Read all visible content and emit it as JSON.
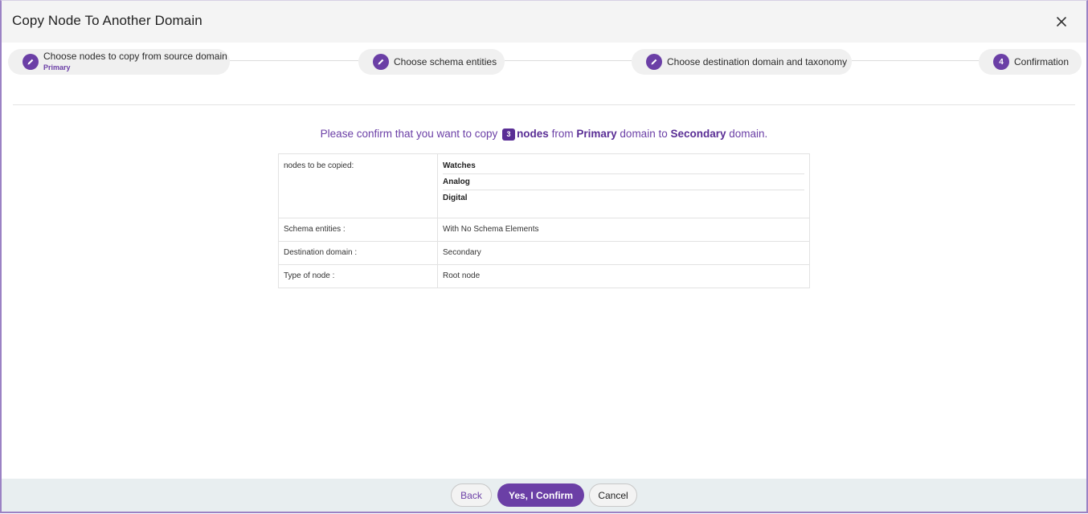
{
  "dialog": {
    "title": "Copy Node To Another Domain",
    "close_icon": "close-icon"
  },
  "stepper": {
    "steps": [
      {
        "label": "Choose nodes to copy from source domain",
        "sub": "Primary",
        "icon": "pencil-icon"
      },
      {
        "label": "Choose schema entities",
        "icon": "pencil-icon"
      },
      {
        "label": "Choose destination domain and taxonomy",
        "icon": "pencil-icon"
      },
      {
        "number": "4",
        "label": "Confirmation"
      }
    ]
  },
  "confirmation": {
    "prefix": "Please confirm that you want to copy",
    "count": "3",
    "nodes_word": "nodes",
    "from_word": "from",
    "source_domain": "Primary",
    "domain_to": "domain to",
    "destination_domain": "Secondary",
    "suffix": "domain."
  },
  "summary": {
    "nodes_label": "nodes to be copied:",
    "nodes": [
      "Watches",
      "Analog",
      "Digital"
    ],
    "rows": [
      {
        "label": "Schema entities :",
        "value": "With No Schema Elements"
      },
      {
        "label": "Destination domain :",
        "value": "Secondary"
      },
      {
        "label": "Type of node :",
        "value": "Root node"
      }
    ]
  },
  "footer": {
    "back_label": "Back",
    "confirm_label": "Yes, I Confirm",
    "cancel_label": "Cancel"
  },
  "colors": {
    "accent": "#6b3fa6",
    "header_bg": "#f4f4f4",
    "footer_bg": "#e8eef0"
  }
}
